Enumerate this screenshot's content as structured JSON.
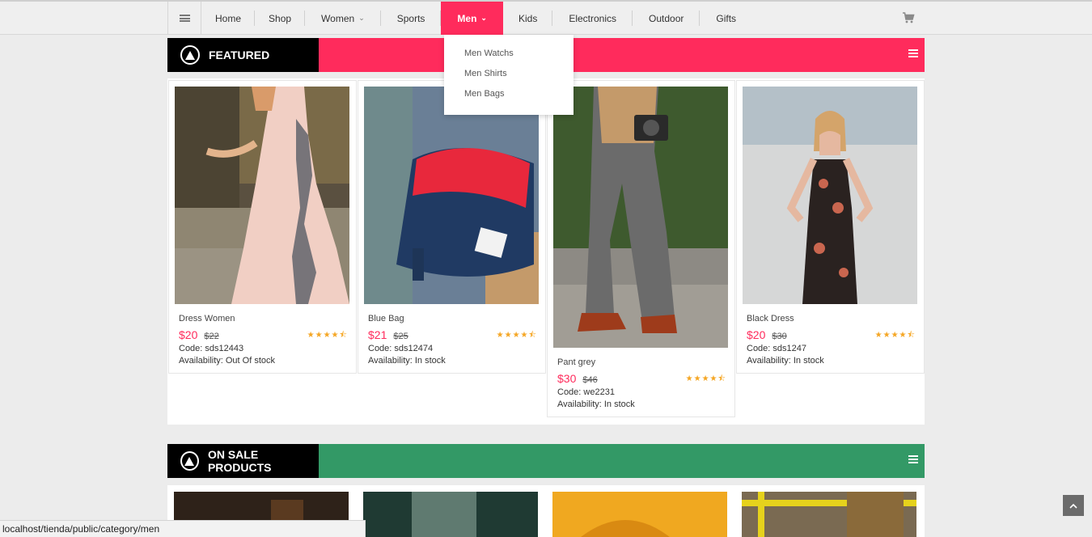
{
  "nav": {
    "items": [
      {
        "label": "Home"
      },
      {
        "label": "Shop"
      },
      {
        "label": "Women"
      },
      {
        "label": "Sports"
      },
      {
        "label": "Men"
      },
      {
        "label": "Kids"
      },
      {
        "label": "Electronics"
      },
      {
        "label": "Outdoor"
      },
      {
        "label": "Gifts"
      }
    ],
    "active": "Men"
  },
  "dropdown": {
    "items": [
      "Men Watchs",
      "Men Shirts",
      "Men Bags"
    ]
  },
  "featured": {
    "title": "FEATURED",
    "color": "#ff2b5c",
    "products": [
      {
        "name": "Dress Women",
        "price": "$20",
        "old_price": "$22",
        "code": "Code: sds12443",
        "availability": "Availability: Out Of stock",
        "rating": 4.5
      },
      {
        "name": "Blue Bag",
        "price": "$21",
        "old_price": "$25",
        "code": "Code: sds12474",
        "availability": "Availability: In stock",
        "rating": 4.5
      },
      {
        "name": "Pant grey",
        "price": "$30",
        "old_price": "$46",
        "code": "Code: we2231",
        "availability": "Availability: In stock",
        "rating": 4.5
      },
      {
        "name": "Black Dress",
        "price": "$20",
        "old_price": "$30",
        "code": "Code: sds1247",
        "availability": "Availability: In stock",
        "rating": 4.5
      }
    ]
  },
  "on_sale": {
    "title": "ON SALE PRODUCTS",
    "color": "#339966"
  },
  "status_url": "localhost/tienda/public/category/men"
}
